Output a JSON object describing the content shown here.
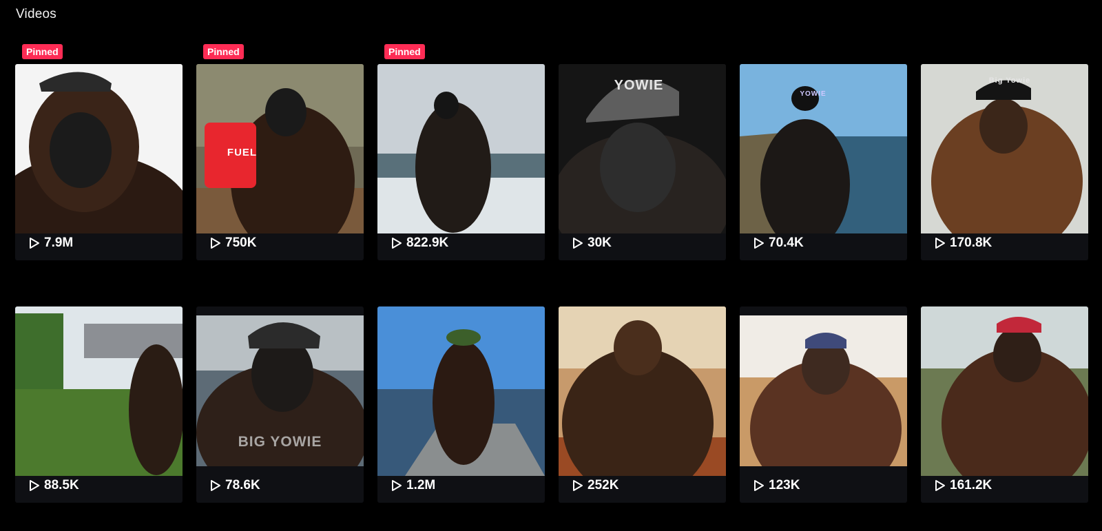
{
  "page": {
    "title": "Videos"
  },
  "videos": [
    {
      "views": "7.9M",
      "pinned": "Pinned",
      "scene": "white"
    },
    {
      "views": "750K",
      "pinned": "Pinned",
      "scene": "forest",
      "overlay": "FUEL"
    },
    {
      "views": "822.9K",
      "pinned": "Pinned",
      "scene": "sea"
    },
    {
      "views": "30K",
      "scene": "dark",
      "overlay": "YOWIE"
    },
    {
      "views": "70.4K",
      "scene": "cliff",
      "overlay": "YOWIE"
    },
    {
      "views": "170.8K",
      "scene": "mist",
      "overlay": "Big Yowie"
    },
    {
      "views": "88.5K",
      "scene": "garden"
    },
    {
      "views": "78.6K",
      "scene": "sky",
      "overlay": "BIG YOWIE"
    },
    {
      "views": "1.2M",
      "scene": "lake"
    },
    {
      "views": "252K",
      "scene": "sunset"
    },
    {
      "views": "123K",
      "scene": "desert"
    },
    {
      "views": "161.2K",
      "scene": "bush"
    }
  ],
  "colors": {
    "pinned_badge": "#fe2c55",
    "tile_bg": "#0f1014",
    "background": "#000000"
  },
  "icons": {
    "views": "play-icon"
  }
}
